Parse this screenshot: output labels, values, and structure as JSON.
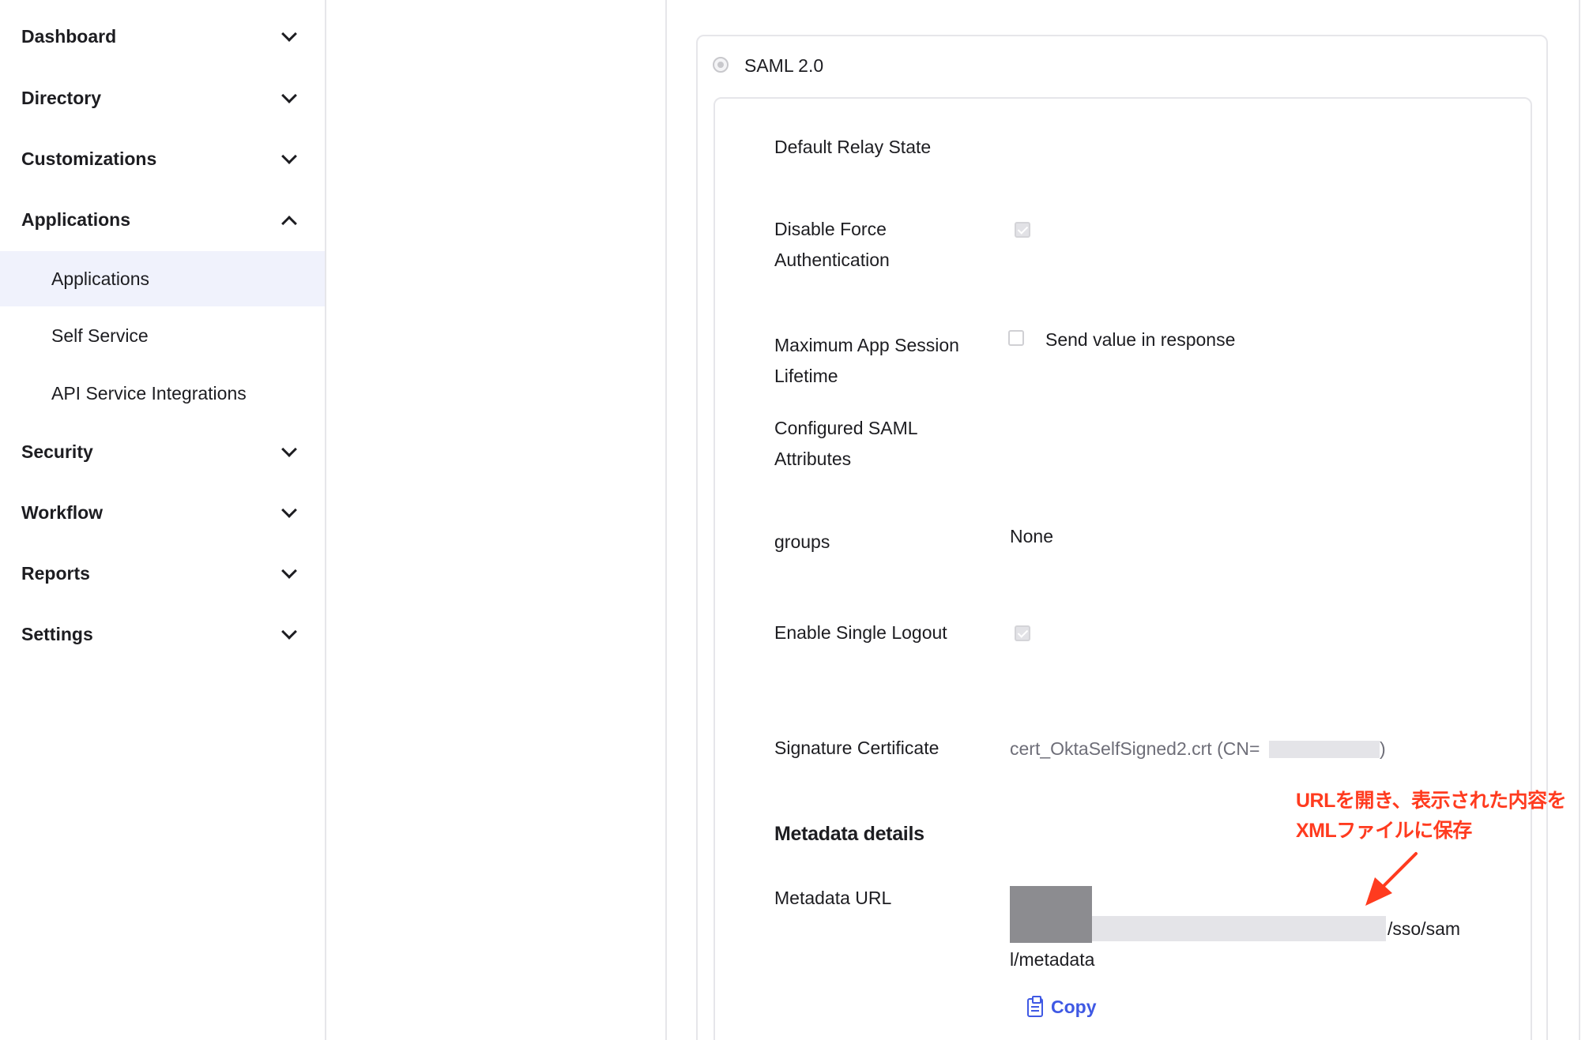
{
  "sidebar": {
    "items": [
      {
        "label": "Dashboard",
        "expanded": false
      },
      {
        "label": "Directory",
        "expanded": false
      },
      {
        "label": "Customizations",
        "expanded": false
      },
      {
        "label": "Applications",
        "expanded": true
      },
      {
        "label": "Security",
        "expanded": false
      },
      {
        "label": "Workflow",
        "expanded": false
      },
      {
        "label": "Reports",
        "expanded": false
      },
      {
        "label": "Settings",
        "expanded": false
      }
    ],
    "applications_sub": [
      {
        "label": "Applications",
        "active": true
      },
      {
        "label": "Self Service",
        "active": false
      },
      {
        "label": "API Service Integrations",
        "active": false
      }
    ]
  },
  "saml": {
    "option_label": "SAML 2.0",
    "default_relay_state_label": "Default Relay State",
    "disable_force_auth_label": "Disable Force Authentication",
    "disable_force_auth_checked": true,
    "max_session_label": "Maximum App Session Lifetime",
    "send_value_label": "Send value in response",
    "send_value_checked": false,
    "configured_attrs_label": "Configured SAML Attributes",
    "groups_label": "groups",
    "groups_value": "None",
    "single_logout_label": "Enable Single Logout",
    "single_logout_checked": true,
    "signature_cert_label": "Signature Certificate",
    "signature_cert_prefix": "cert_OktaSelfSigned2.crt (CN=",
    "signature_cert_suffix": ")",
    "metadata_title": "Metadata details",
    "metadata_url_label": "Metadata URL",
    "metadata_url_tail1": "/sso/sam",
    "metadata_url_tail2": "l/metadata",
    "copy_label": "Copy"
  },
  "annotation": {
    "line1": "URLを開き、表示された内容を",
    "line2": "XMLファイルに保存",
    "color": "#ff3b1f"
  },
  "colors": {
    "accent": "#3f59e4",
    "active_bg": "#f0f2fc"
  }
}
